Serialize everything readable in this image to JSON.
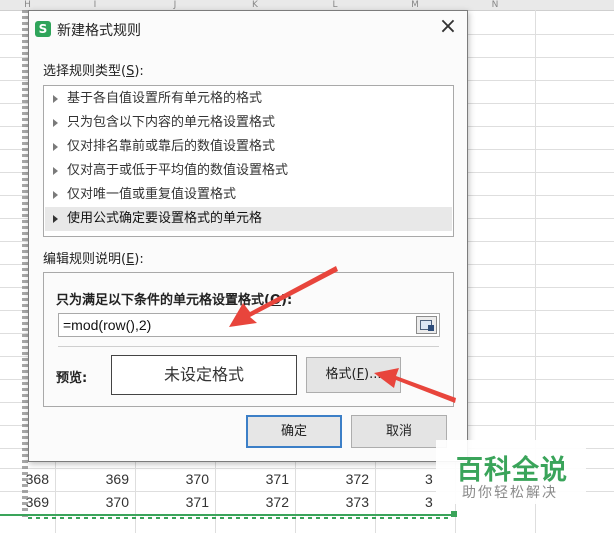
{
  "sheet": {
    "column_headers": [
      "H",
      "I",
      "J",
      "K",
      "L",
      "M",
      "N"
    ],
    "rows": [
      [
        "368",
        "369",
        "370",
        "371",
        "372",
        "3"
      ],
      [
        "369",
        "370",
        "371",
        "372",
        "373",
        "3"
      ]
    ],
    "accent_color": "#3aa45a"
  },
  "dialog": {
    "icon_glyph": "S",
    "title": "新建格式规则",
    "close_glyph": "×",
    "rule_type_label": "选择规则类型(",
    "rule_type_key": "S",
    "rule_type_suffix": "):",
    "rule_types": [
      "基于各自值设置所有单元格的格式",
      "只为包含以下内容的单元格设置格式",
      "仅对排名靠前或靠后的数值设置格式",
      "仅对高于或低于平均值的数值设置格式",
      "仅对唯一值或重复值设置格式",
      "使用公式确定要设置格式的单元格"
    ],
    "selected_rule_type_index": 5,
    "edit_label": "编辑规则说明(",
    "edit_key": "E",
    "edit_suffix": "):",
    "condition_label": "只为满足以下条件的单元格设置格式(",
    "condition_key": "O",
    "condition_suffix": "):",
    "formula_value": "=mod(row(),2)",
    "preview_label": "预览:",
    "preview_text": "未设定格式",
    "format_button_label": "格式(",
    "format_button_key": "F",
    "format_button_suffix": ")...",
    "ok_button": "确定",
    "cancel_button": "取消",
    "accent_color": "#3c7fc7"
  },
  "annotations": {
    "arrow_color": "#e8453c"
  },
  "watermark": {
    "title": "百科全说",
    "subtitle": "助你轻松解决"
  }
}
